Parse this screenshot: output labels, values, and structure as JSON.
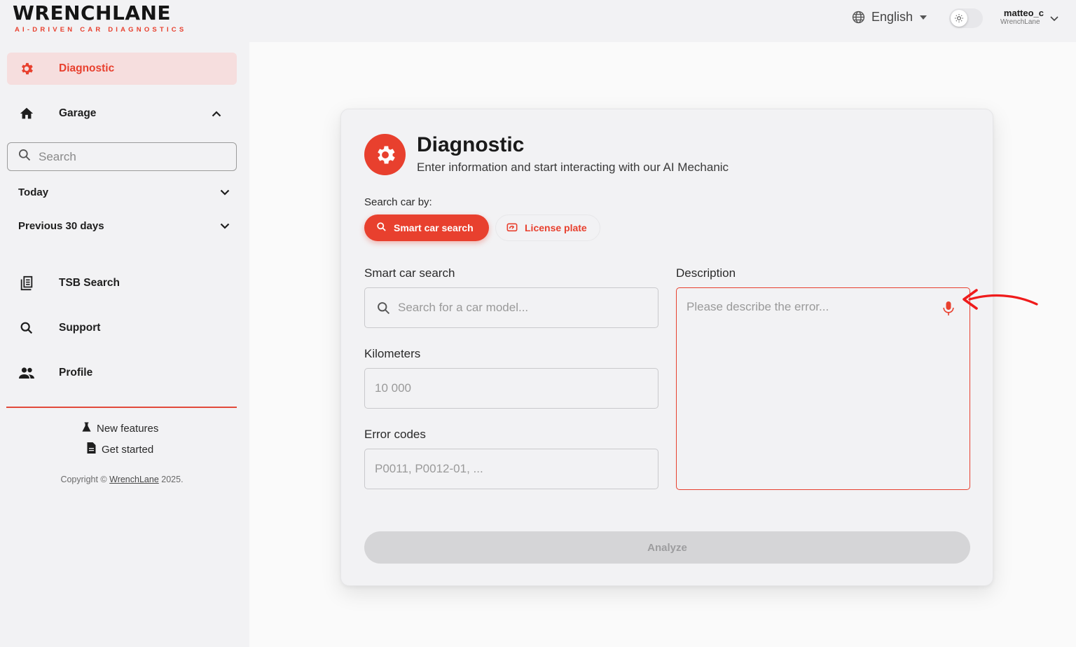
{
  "brand": {
    "name": "WRENCHLANE",
    "tagline": "AI-DRIVEN CAR DIAGNOSTICS",
    "accent_color": "#e8402e"
  },
  "header": {
    "language": "English",
    "theme_toggle_icon": "sun-icon",
    "user": {
      "name": "matteo_c",
      "org": "WrenchLane"
    }
  },
  "sidebar": {
    "primary": {
      "label": "Diagnostic",
      "icon": "gear-icon",
      "active": true
    },
    "garage": {
      "label": "Garage",
      "icon": "home-icon",
      "expanded": true
    },
    "search_placeholder": "Search",
    "groups": [
      {
        "label": "Today"
      },
      {
        "label": "Previous 30 days"
      }
    ],
    "items": [
      {
        "label": "TSB Search",
        "icon": "document-list-icon"
      },
      {
        "label": "Support",
        "icon": "search-icon"
      },
      {
        "label": "Profile",
        "icon": "people-icon"
      }
    ],
    "footer_links": [
      {
        "label": "New features",
        "icon": "flask-icon"
      },
      {
        "label": "Get started",
        "icon": "file-icon"
      }
    ],
    "copyright_prefix": "Copyright ©",
    "copyright_link": "WrenchLane",
    "copyright_suffix": "2025."
  },
  "card": {
    "title": "Diagnostic",
    "subtitle": "Enter information and start interacting with our AI Mechanic",
    "search_by_label": "Search car by:",
    "tabs": [
      {
        "label": "Smart car search",
        "icon": "search-icon",
        "active": true
      },
      {
        "label": "License plate",
        "icon": "gauge-icon",
        "active": false
      }
    ],
    "smart_search": {
      "label": "Smart car search",
      "placeholder": "Search for a car model..."
    },
    "kilometers": {
      "label": "Kilometers",
      "placeholder": "10 000"
    },
    "error_codes": {
      "label": "Error codes",
      "placeholder": "P0011, P0012-01, ..."
    },
    "description": {
      "label": "Description",
      "placeholder": "Please describe the error...",
      "icon": "microphone-icon"
    },
    "analyze_button": "Analyze"
  }
}
